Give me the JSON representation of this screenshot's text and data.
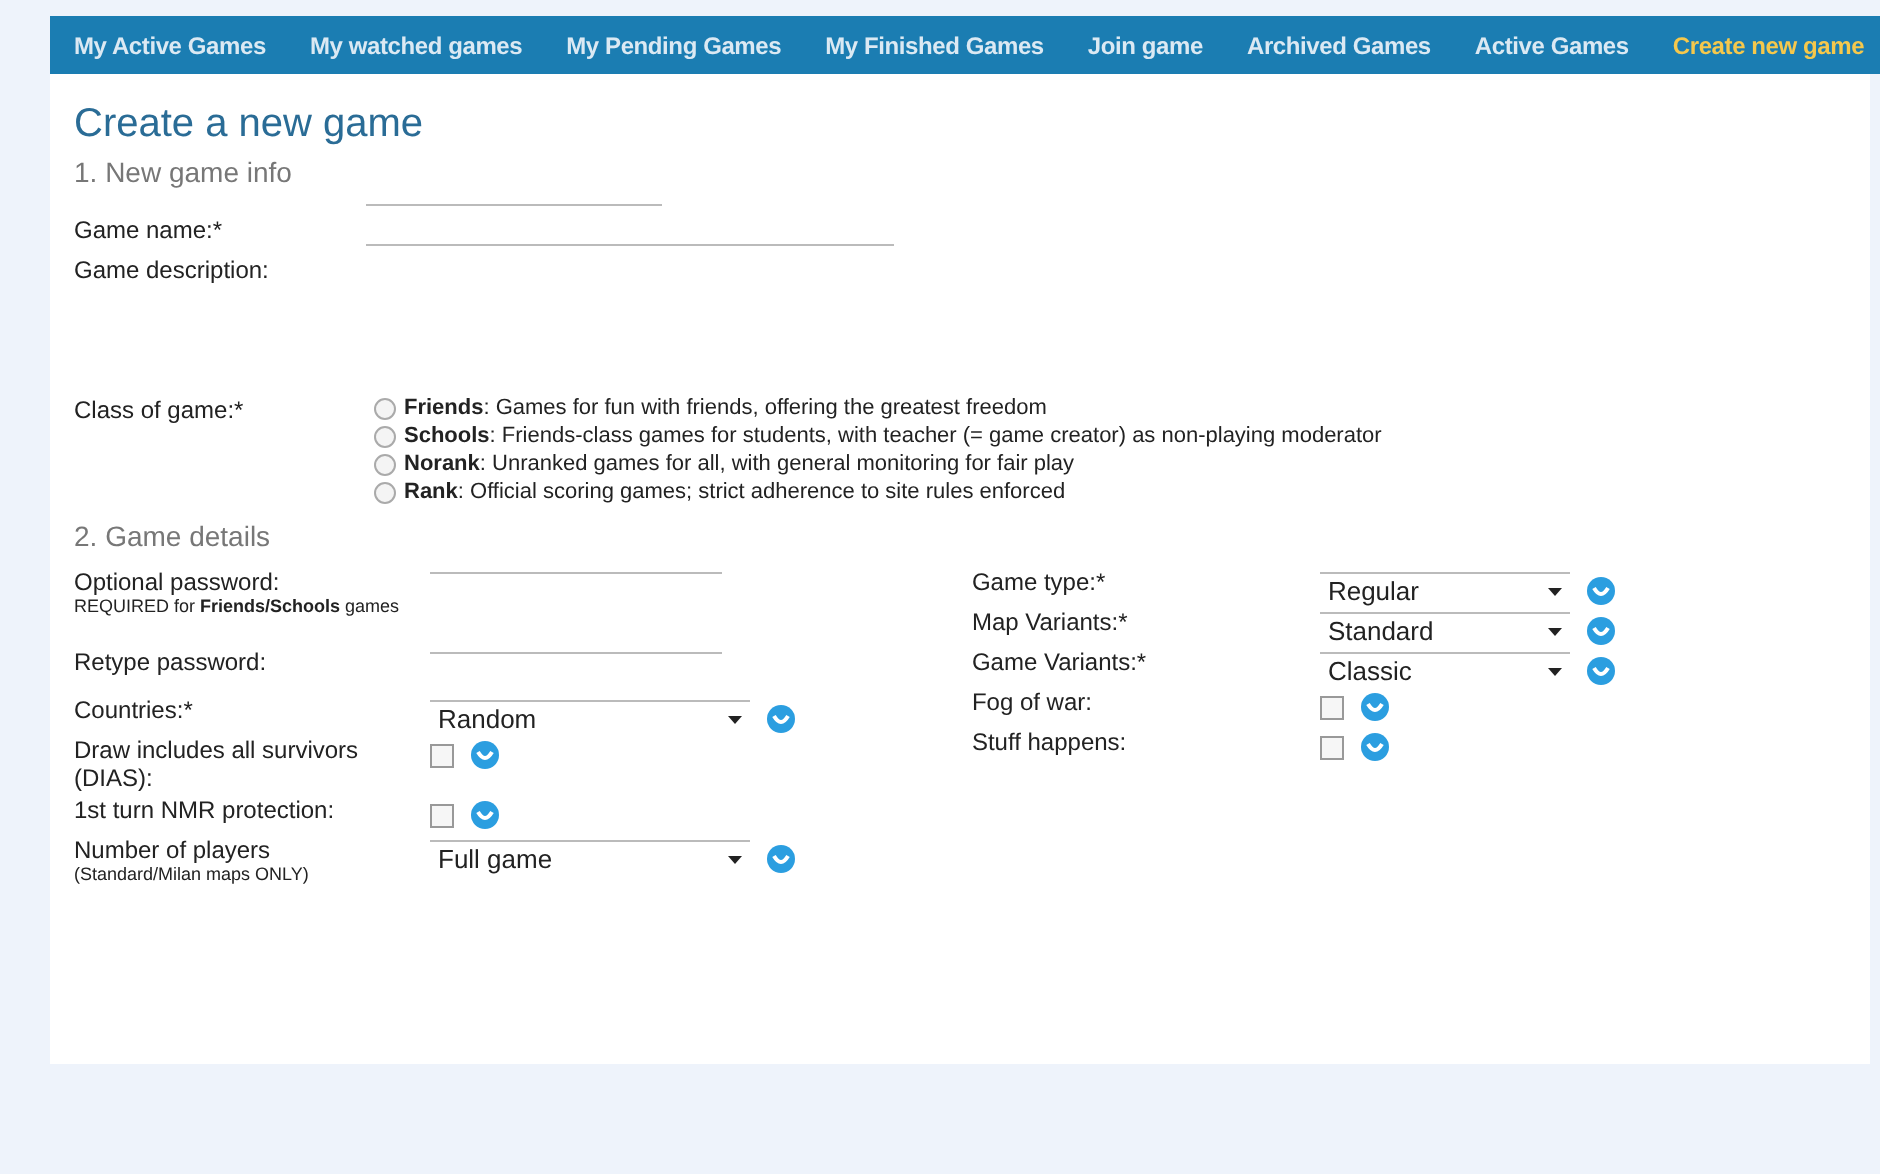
{
  "nav": [
    {
      "label": "My Active Games",
      "selected": false
    },
    {
      "label": "My watched games",
      "selected": false
    },
    {
      "label": "My Pending Games",
      "selected": false
    },
    {
      "label": "My Finished Games",
      "selected": false
    },
    {
      "label": "Join game",
      "selected": false
    },
    {
      "label": "Archived Games",
      "selected": false
    },
    {
      "label": "Active Games",
      "selected": false
    },
    {
      "label": "Create new game",
      "selected": true
    }
  ],
  "title": "Create a new game",
  "section1": {
    "heading": "1. New game info",
    "game_name": {
      "label": "Game name:*"
    },
    "description": {
      "label": "Game description:"
    },
    "class_of_game": {
      "label": "Class of game:*",
      "options": [
        {
          "text": "**Friends**: Games for fun with friends, offering the greatest freedom",
          "selected": false
        },
        {
          "text": "**Schools**: Friends-class games for students, with teacher (= game creator) as non-playing moderator",
          "selected": false
        },
        {
          "text": "**Norank**: Unranked games for all, with general monitoring for fair play",
          "selected": false
        },
        {
          "text": "**Rank**: Official scoring games; strict adherence to site rules enforced",
          "selected": false
        }
      ]
    }
  },
  "section2": {
    "heading": "2. Game details",
    "left": [
      {
        "kind": "password",
        "label": "Optional password:",
        "note": "REQUIRED for **Friends/Schools** games"
      },
      {
        "kind": "password",
        "label": "Retype password:"
      },
      {
        "kind": "select",
        "label": "Countries:*",
        "value": "Random"
      },
      {
        "kind": "checkbox",
        "label": "Draw includes all survivors (DIAS):",
        "checked": false
      },
      {
        "kind": "checkbox",
        "label": "1st turn NMR protection:",
        "checked": false
      },
      {
        "kind": "select",
        "label": "Number of players",
        "note": "(Standard/Milan maps ONLY)",
        "value": "Full game"
      }
    ],
    "right": [
      {
        "kind": "select",
        "label": "Game type:*",
        "value": "Regular"
      },
      {
        "kind": "select",
        "label": "Map Variants:*",
        "value": "Standard"
      },
      {
        "kind": "select",
        "label": "Game Variants:*",
        "value": "Classic"
      },
      {
        "kind": "checkbox",
        "label": "Fog of war:",
        "checked": false
      },
      {
        "kind": "checkbox",
        "label": "Stuff happens:",
        "checked": false
      }
    ]
  }
}
